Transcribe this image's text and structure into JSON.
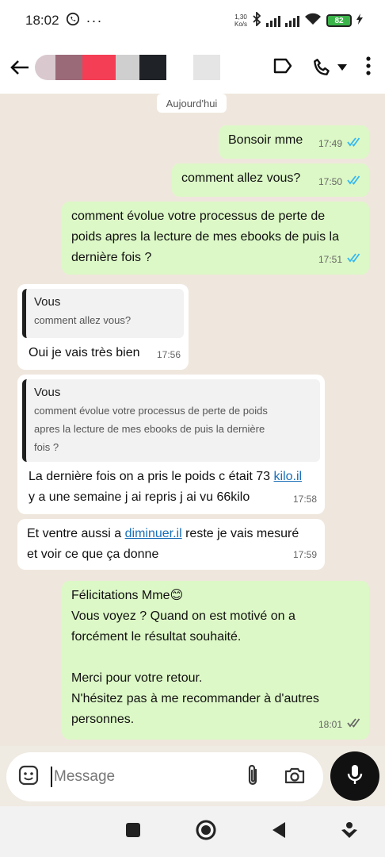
{
  "status_bar": {
    "time": "18:02",
    "speed_value": "1,30",
    "speed_unit": "Ko/s",
    "battery": "82"
  },
  "header": {
    "contact_name_hidden": true
  },
  "chat": {
    "date_chip": "Aujourd'hui",
    "messages": [
      {
        "dir": "out",
        "text": "Bonsoir mme",
        "time": "17:49"
      },
      {
        "dir": "out",
        "text": "comment allez vous?",
        "time": "17:50"
      },
      {
        "dir": "out",
        "lines": [
          "comment évolue votre processus de perte de",
          "poids apres la lecture de mes ebooks de puis la",
          "dernière fois ?"
        ],
        "time": "17:51"
      },
      {
        "dir": "in",
        "quote_author": "Vous",
        "quote_text": "comment allez vous?",
        "text": "Oui je vais très bien",
        "time": "17:56"
      },
      {
        "dir": "in",
        "quote_author": "Vous",
        "quote_lines": [
          "comment évolue votre processus de perte de poids",
          "apres la lecture de mes ebooks de puis la dernière",
          "fois ?"
        ],
        "line1_prefix": "La dernière fois on a pris le poids c était 73 ",
        "line1_link": "kilo.il",
        "line2": "y a une semaine j ai repris j ai vu 66kilo",
        "time": "17:58"
      },
      {
        "dir": "in",
        "line1_prefix": "Et ventre aussi a ",
        "line1_link": "diminuer.il",
        "line1_suffix": " reste je vais mesuré",
        "line2": "et voir ce que ça donne",
        "time": "17:59"
      },
      {
        "dir": "out",
        "lines": [
          "Félicitations Mme😊",
          "Vous voyez ? Quand on est motivé on a",
          "forcément le résultat souhaité.",
          "",
          "Merci pour votre retour.",
          "N'hésitez pas à me recommander à d'autres",
          "personnes."
        ],
        "time": "18:01"
      }
    ]
  },
  "input": {
    "placeholder": "Message"
  },
  "colors": {
    "outgoing_bubble": "#dcf8c6",
    "incoming_bubble": "#ffffff",
    "read_ticks": "#34b7f1",
    "chat_background": "#efe7dd",
    "link": "#1a6fb8"
  }
}
